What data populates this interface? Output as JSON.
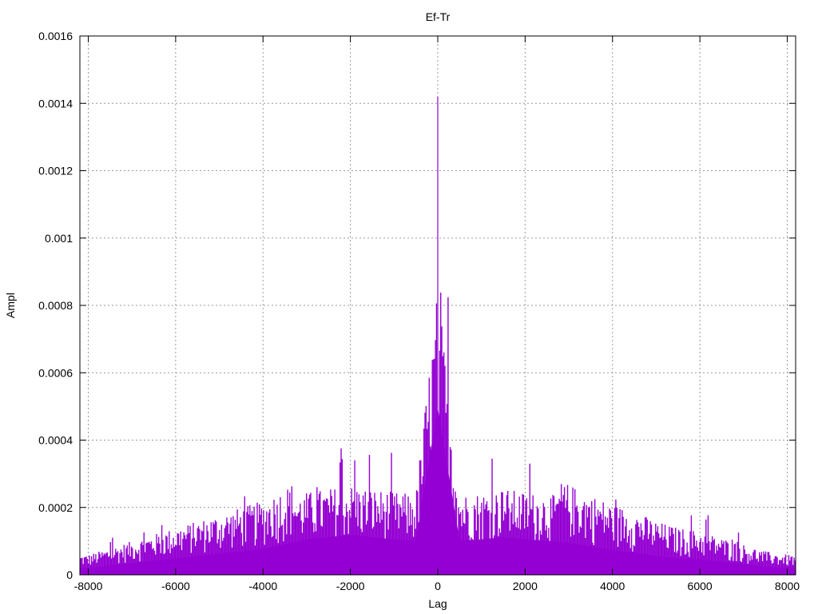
{
  "chart_data": {
    "type": "bar",
    "title": "Ef-Tr",
    "xlabel": "Lag",
    "ylabel": "Ampl",
    "xlim": [
      -8192,
      8192
    ],
    "ylim": [
      0,
      0.0016
    ],
    "x_ticks": [
      -8000,
      -6000,
      -4000,
      -2000,
      0,
      2000,
      4000,
      6000,
      8000
    ],
    "x_tick_labels": [
      "-8000",
      "-6000",
      "-4000",
      "-2000",
      "0",
      "2000",
      "4000",
      "6000",
      "8000"
    ],
    "y_ticks": [
      0,
      0.0002,
      0.0004,
      0.0006,
      0.0008,
      0.001,
      0.0012,
      0.0014,
      0.0016
    ],
    "y_tick_labels": [
      "0",
      "0.0002",
      "0.0004",
      "0.0006",
      "0.0008",
      "0.001",
      "0.0012",
      "0.0014",
      "0.0016"
    ],
    "grid": true,
    "series_color": "#9400d3",
    "series": [
      {
        "x": [
          -8000,
          -7500,
          -7000,
          -6500,
          -6000,
          -5500,
          -5000,
          -4500,
          -4000,
          -3500,
          -3000,
          -2500,
          -2000,
          -1500,
          -1000,
          -500,
          0,
          500,
          1000,
          1500,
          2000,
          2500,
          3000,
          3500,
          4000,
          4500,
          5000,
          5500,
          6000,
          6500,
          7000,
          7500,
          8000
        ],
        "y": [
          6e-05,
          8e-05,
          0.0001,
          0.00012,
          0.00014,
          0.00016,
          0.00018,
          0.0002,
          0.00022,
          0.00026,
          0.0003,
          0.00032,
          0.00034,
          0.00032,
          0.0003,
          0.00029,
          0.00142,
          0.00029,
          0.0003,
          0.00032,
          0.0003,
          0.00029,
          0.00027,
          0.00024,
          0.00021,
          0.00019,
          0.00016,
          0.00014,
          0.00013,
          0.00011,
          9e-05,
          7e-05,
          6e-05
        ]
      }
    ]
  }
}
